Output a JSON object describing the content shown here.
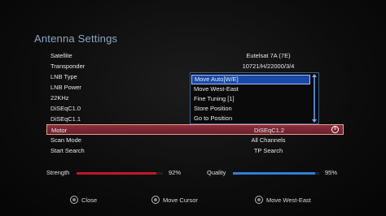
{
  "title": "Antenna Settings",
  "rows": [
    {
      "label": "Satellite",
      "value": "Eutelsat 7A (7E)"
    },
    {
      "label": "Transponder",
      "value": "10721/H/22000/3/4"
    },
    {
      "label": "LNB Type",
      "value": ""
    },
    {
      "label": "LNB Power",
      "value": ""
    },
    {
      "label": "22KHz",
      "value": ""
    },
    {
      "label": "DiSEqC1.0",
      "value": ""
    },
    {
      "label": "DiSEqC1.1",
      "value": ""
    },
    {
      "label": "Motor",
      "value": "DiSEqC1.2"
    },
    {
      "label": "Scan Mode",
      "value": "All Channels"
    },
    {
      "label": "Start Search",
      "value": "TP Search"
    }
  ],
  "dropdown": {
    "items": [
      "Move Auto[W/E]",
      "Move West-East",
      "Fine Tuning [1]",
      "Store Position",
      "Go to Position"
    ],
    "selected_index": 0
  },
  "strength": {
    "label": "Strength",
    "value": "92%",
    "level": 0.92,
    "color": "#c0182a"
  },
  "quality": {
    "label": "Quality",
    "value": "95%",
    "level": 0.95,
    "color": "#2f7fd8"
  },
  "footer": {
    "close": "Close",
    "move_cursor": "Move Cursor",
    "move_west_east": "Move West-East"
  },
  "colors": {
    "selection": "#8a2f3f",
    "dropdown_active": "#1a4aa8",
    "title": "#8aa8c6"
  }
}
